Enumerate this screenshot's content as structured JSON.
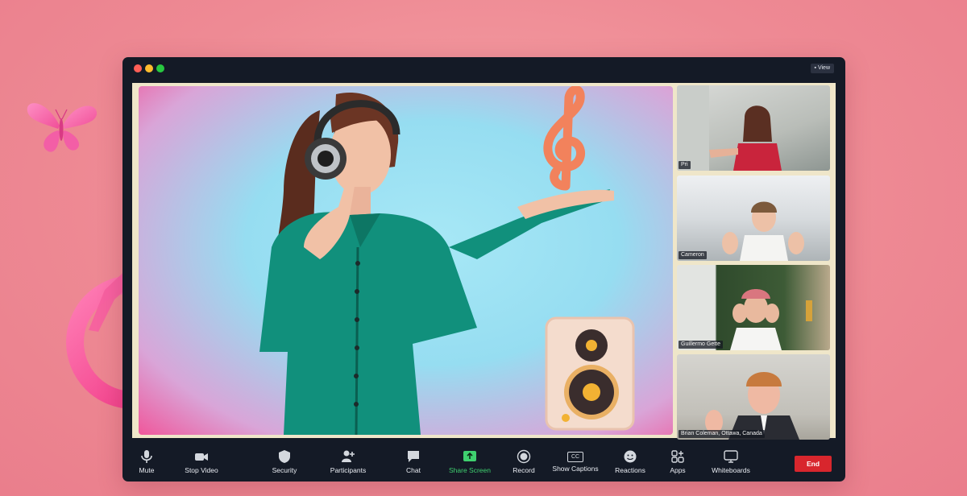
{
  "window": {
    "view_label": "View",
    "traffic_lights": {
      "close": "#ff5f57",
      "minimize": "#febc2e",
      "maximize": "#28c840"
    }
  },
  "participants": [
    {
      "name": "Pri"
    },
    {
      "name": "Cameron"
    },
    {
      "name": "Guillermo Gette"
    },
    {
      "name": "Brian Coleman, Ottawa, Canada"
    }
  ],
  "toolbar": {
    "mute": "Mute",
    "stop_video": "Stop Video",
    "security": "Security",
    "participants": "Participants",
    "chat": "Chat",
    "share_screen": "Share Screen",
    "record": "Record",
    "show_captions": "Show Captions",
    "captions_icon_text": "CC",
    "reactions": "Reactions",
    "apps": "Apps",
    "whiteboards": "Whiteboards",
    "end": "End"
  },
  "colors": {
    "background": "#ee8a94",
    "window": "#141a26",
    "stage_border": "#efe6c9",
    "share_green": "#3fd06f",
    "end_red": "#d8262d",
    "accent_pink": "#f0579b"
  },
  "icons": {
    "decor": [
      "butterfly-icon",
      "female-symbol-icon",
      "treble-clef-icon",
      "speaker-icon",
      "headphones-icon"
    ],
    "toolbar": [
      "microphone-icon",
      "video-camera-icon",
      "shield-icon",
      "participants-icon",
      "chat-icon",
      "share-screen-icon",
      "record-icon",
      "captions-icon",
      "reactions-icon",
      "apps-icon",
      "whiteboard-icon"
    ]
  }
}
